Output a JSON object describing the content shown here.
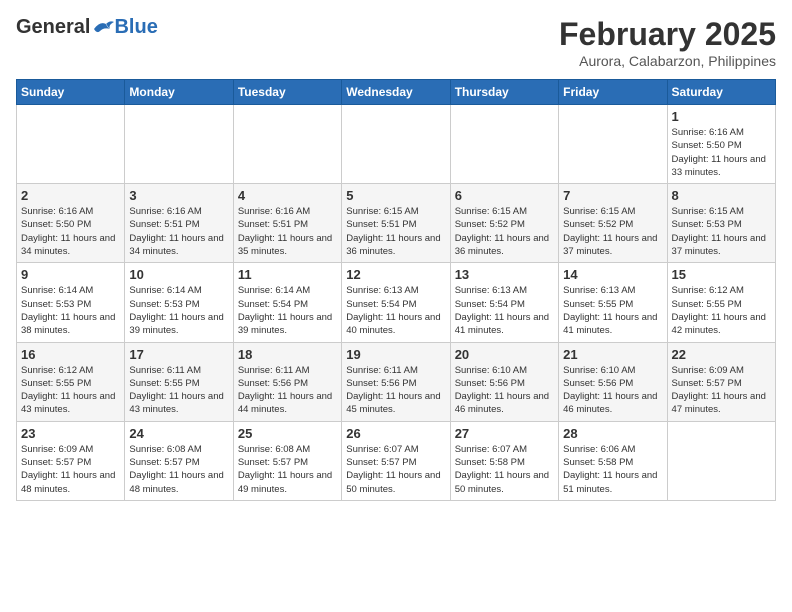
{
  "header": {
    "logo_general": "General",
    "logo_blue": "Blue",
    "month_title": "February 2025",
    "location": "Aurora, Calabarzon, Philippines"
  },
  "weekdays": [
    "Sunday",
    "Monday",
    "Tuesday",
    "Wednesday",
    "Thursday",
    "Friday",
    "Saturday"
  ],
  "weeks": [
    [
      {
        "day": "",
        "info": ""
      },
      {
        "day": "",
        "info": ""
      },
      {
        "day": "",
        "info": ""
      },
      {
        "day": "",
        "info": ""
      },
      {
        "day": "",
        "info": ""
      },
      {
        "day": "",
        "info": ""
      },
      {
        "day": "1",
        "info": "Sunrise: 6:16 AM\nSunset: 5:50 PM\nDaylight: 11 hours and 33 minutes."
      }
    ],
    [
      {
        "day": "2",
        "info": "Sunrise: 6:16 AM\nSunset: 5:50 PM\nDaylight: 11 hours and 34 minutes."
      },
      {
        "day": "3",
        "info": "Sunrise: 6:16 AM\nSunset: 5:51 PM\nDaylight: 11 hours and 34 minutes."
      },
      {
        "day": "4",
        "info": "Sunrise: 6:16 AM\nSunset: 5:51 PM\nDaylight: 11 hours and 35 minutes."
      },
      {
        "day": "5",
        "info": "Sunrise: 6:15 AM\nSunset: 5:51 PM\nDaylight: 11 hours and 36 minutes."
      },
      {
        "day": "6",
        "info": "Sunrise: 6:15 AM\nSunset: 5:52 PM\nDaylight: 11 hours and 36 minutes."
      },
      {
        "day": "7",
        "info": "Sunrise: 6:15 AM\nSunset: 5:52 PM\nDaylight: 11 hours and 37 minutes."
      },
      {
        "day": "8",
        "info": "Sunrise: 6:15 AM\nSunset: 5:53 PM\nDaylight: 11 hours and 37 minutes."
      }
    ],
    [
      {
        "day": "9",
        "info": "Sunrise: 6:14 AM\nSunset: 5:53 PM\nDaylight: 11 hours and 38 minutes."
      },
      {
        "day": "10",
        "info": "Sunrise: 6:14 AM\nSunset: 5:53 PM\nDaylight: 11 hours and 39 minutes."
      },
      {
        "day": "11",
        "info": "Sunrise: 6:14 AM\nSunset: 5:54 PM\nDaylight: 11 hours and 39 minutes."
      },
      {
        "day": "12",
        "info": "Sunrise: 6:13 AM\nSunset: 5:54 PM\nDaylight: 11 hours and 40 minutes."
      },
      {
        "day": "13",
        "info": "Sunrise: 6:13 AM\nSunset: 5:54 PM\nDaylight: 11 hours and 41 minutes."
      },
      {
        "day": "14",
        "info": "Sunrise: 6:13 AM\nSunset: 5:55 PM\nDaylight: 11 hours and 41 minutes."
      },
      {
        "day": "15",
        "info": "Sunrise: 6:12 AM\nSunset: 5:55 PM\nDaylight: 11 hours and 42 minutes."
      }
    ],
    [
      {
        "day": "16",
        "info": "Sunrise: 6:12 AM\nSunset: 5:55 PM\nDaylight: 11 hours and 43 minutes."
      },
      {
        "day": "17",
        "info": "Sunrise: 6:11 AM\nSunset: 5:55 PM\nDaylight: 11 hours and 43 minutes."
      },
      {
        "day": "18",
        "info": "Sunrise: 6:11 AM\nSunset: 5:56 PM\nDaylight: 11 hours and 44 minutes."
      },
      {
        "day": "19",
        "info": "Sunrise: 6:11 AM\nSunset: 5:56 PM\nDaylight: 11 hours and 45 minutes."
      },
      {
        "day": "20",
        "info": "Sunrise: 6:10 AM\nSunset: 5:56 PM\nDaylight: 11 hours and 46 minutes."
      },
      {
        "day": "21",
        "info": "Sunrise: 6:10 AM\nSunset: 5:56 PM\nDaylight: 11 hours and 46 minutes."
      },
      {
        "day": "22",
        "info": "Sunrise: 6:09 AM\nSunset: 5:57 PM\nDaylight: 11 hours and 47 minutes."
      }
    ],
    [
      {
        "day": "23",
        "info": "Sunrise: 6:09 AM\nSunset: 5:57 PM\nDaylight: 11 hours and 48 minutes."
      },
      {
        "day": "24",
        "info": "Sunrise: 6:08 AM\nSunset: 5:57 PM\nDaylight: 11 hours and 48 minutes."
      },
      {
        "day": "25",
        "info": "Sunrise: 6:08 AM\nSunset: 5:57 PM\nDaylight: 11 hours and 49 minutes."
      },
      {
        "day": "26",
        "info": "Sunrise: 6:07 AM\nSunset: 5:57 PM\nDaylight: 11 hours and 50 minutes."
      },
      {
        "day": "27",
        "info": "Sunrise: 6:07 AM\nSunset: 5:58 PM\nDaylight: 11 hours and 50 minutes."
      },
      {
        "day": "28",
        "info": "Sunrise: 6:06 AM\nSunset: 5:58 PM\nDaylight: 11 hours and 51 minutes."
      },
      {
        "day": "",
        "info": ""
      }
    ]
  ]
}
